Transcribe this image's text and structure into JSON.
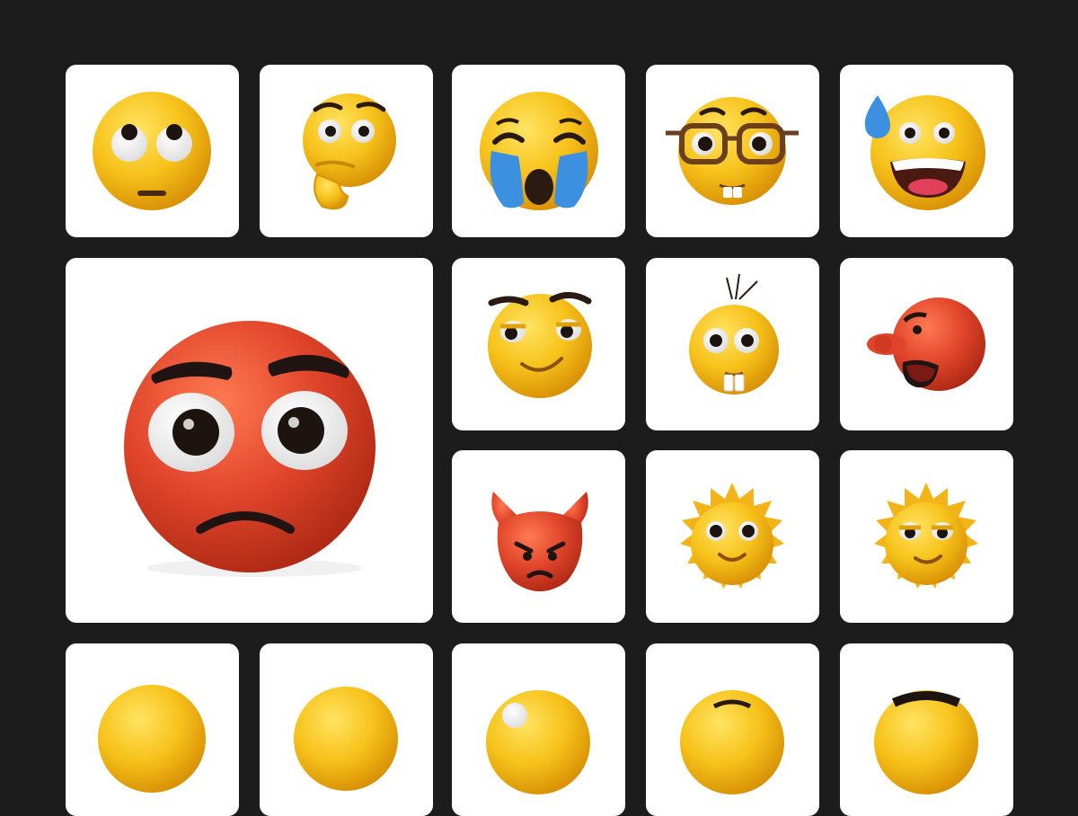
{
  "colors": {
    "background": "#1c1c1c",
    "tile": "#ffffff",
    "emoji_yellow": "#f7c21a",
    "emoji_red": "#e0452a",
    "tear_blue": "#3d8fe0"
  },
  "emojis": [
    {
      "name": "face-with-rolling-eyes-icon",
      "color": "yellow"
    },
    {
      "name": "thinking-face-icon",
      "color": "yellow"
    },
    {
      "name": "loudly-crying-face-icon",
      "color": "yellow"
    },
    {
      "name": "nerd-face-with-glasses-icon",
      "color": "yellow"
    },
    {
      "name": "grinning-face-with-sweat-icon",
      "color": "yellow"
    },
    {
      "name": "angry-red-face-icon",
      "color": "red"
    },
    {
      "name": "smirking-face-icon",
      "color": "yellow"
    },
    {
      "name": "bucktooth-face-with-antennae-icon",
      "color": "yellow"
    },
    {
      "name": "red-long-nose-shouting-face-icon",
      "color": "red"
    },
    {
      "name": "red-devil-angry-face-icon",
      "color": "red"
    },
    {
      "name": "fuzzy-smiling-monster-icon",
      "color": "yellow"
    },
    {
      "name": "fuzzy-smirking-monster-icon",
      "color": "yellow"
    },
    {
      "name": "yellow-face-partial-icon",
      "color": "yellow"
    },
    {
      "name": "yellow-face-partial-icon",
      "color": "yellow"
    },
    {
      "name": "yellow-face-partial-icon",
      "color": "yellow"
    },
    {
      "name": "yellow-face-partial-icon",
      "color": "yellow"
    },
    {
      "name": "yellow-face-partial-icon",
      "color": "yellow"
    }
  ]
}
